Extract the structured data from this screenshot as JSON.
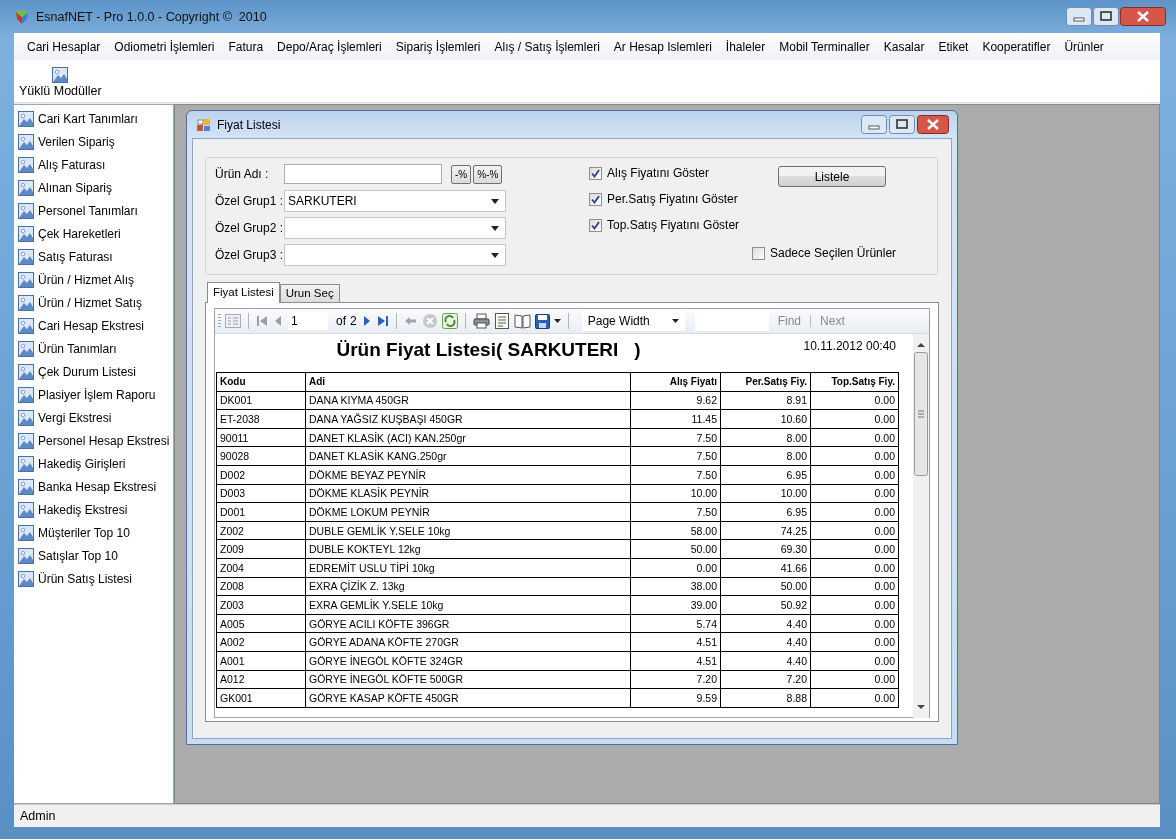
{
  "window": {
    "title": "EsnafNET - Pro 1.0.0 - Copyright ©  2010"
  },
  "menu": [
    "Cari Hesaplar",
    "Odiometri İşlemleri",
    "Fatura",
    "Depo/Araç İşlemleri",
    "Sipariş İşlemleri",
    "Alış / Satış İşlemleri",
    "Ar Hesap Islemleri",
    "İhaleler",
    "Mobil Terminaller",
    "Kasalar",
    "Etiket",
    "Kooperatifler",
    "Ürünler"
  ],
  "toolbar": [
    {
      "label": "Yüklü Modüller"
    }
  ],
  "sidebar": {
    "items": [
      "Cari Kart Tanımları",
      "Verilen Sipariş",
      "Alış Faturası",
      "Alınan Sipariş",
      "Personel Tanımları",
      "Çek Hareketleri",
      "Satış Faturası",
      "Ürün / Hizmet Alış",
      "Ürün / Hizmet Satış",
      "Cari Hesap Ekstresi",
      "Ürün Tanımları",
      "Çek Durum Listesi",
      "Plasiyer İşlem Raporu",
      "Vergi Ekstresi",
      "Personel Hesap Ekstresi",
      "Hakediş Girişleri",
      "Banka Hesap Ekstresi",
      "Hakediş Ekstresi",
      "Müşteriler Top 10",
      "Satışlar Top 10",
      "Ürün Satış Listesi"
    ]
  },
  "child_window": {
    "title": "Fiyat Listesi",
    "fields": [
      {
        "label": "Ürün Adı :",
        "kind": "text"
      },
      {
        "label": "Özel Grup1 :",
        "kind": "combo",
        "value": "SARKUTERI"
      },
      {
        "label": "Özel Grup2 :",
        "kind": "combo"
      },
      {
        "label": "Özel Grup3 :",
        "kind": "combo"
      }
    ],
    "pattern_buttons": [
      "-%",
      "%-%"
    ],
    "checkboxes": [
      {
        "label": "Alış Fiyatını Göster",
        "checked": true
      },
      {
        "label": "Per.Satış Fiyatını Göster",
        "checked": true
      },
      {
        "label": "Top.Satış Fiyatını Göster",
        "checked": true
      }
    ],
    "list_button": "Listele",
    "only_selected": {
      "label": "Sadece Seçilen Ürünler",
      "checked": false
    },
    "tabs": [
      {
        "label": "Fiyat Listesi",
        "selected": true
      },
      {
        "label": "Urun Seç",
        "selected": false
      }
    ],
    "report_toolbar": {
      "page": "1",
      "of": "of",
      "total": "2",
      "zoom": "Page Width",
      "find": {
        "label": "Find",
        "disabled": true
      },
      "next": {
        "label": "Next",
        "disabled": true
      }
    },
    "report": {
      "title": "Ürün Fiyat Listesi( SARKUTERI   )",
      "date": "10.11.2012 00:40",
      "columns": [
        {
          "label": "Kodu",
          "kind": "text"
        },
        {
          "label": "Adi",
          "kind": "text"
        },
        {
          "label": "Alış Fiyatı",
          "kind": "number"
        },
        {
          "label": "Per.Satış Fiy.",
          "kind": "number"
        },
        {
          "label": "Top.Satış Fiy.",
          "kind": "number"
        }
      ],
      "rows": [
        [
          "DK001",
          "DANA KIYMA 450GR",
          "9.62",
          "8.91",
          "0.00"
        ],
        [
          "ET-2038",
          "DANA YAĞSIZ KUŞBAŞI 450GR",
          "11.45",
          "10.60",
          "0.00"
        ],
        [
          "90011",
          "DANET KLASİK (ACI) KAN.250gr",
          "7.50",
          "8.00",
          "0.00"
        ],
        [
          "90028",
          "DANET KLASİK KANG.250gr",
          "7.50",
          "8.00",
          "0.00"
        ],
        [
          "D002",
          "DÖKME BEYAZ PEYNİR",
          "7.50",
          "6.95",
          "0.00"
        ],
        [
          "D003",
          "DÖKME KLASİK PEYNİR",
          "10.00",
          "10.00",
          "0.00"
        ],
        [
          "D001",
          "DÖKME LOKUM PEYNİR",
          "7.50",
          "6.95",
          "0.00"
        ],
        [
          "Z002",
          "DUBLE GEMLİK Y.SELE 10kg",
          "58.00",
          "74.25",
          "0.00"
        ],
        [
          "Z009",
          "DUBLE KOKTEYL 12kg",
          "50.00",
          "69.30",
          "0.00"
        ],
        [
          "Z004",
          "EDREMİT USLU TİPİ 10kg",
          "0.00",
          "41.66",
          "0.00"
        ],
        [
          "Z008",
          "EXRA ÇİZİK Z. 13kg",
          "38.00",
          "50.00",
          "0.00"
        ],
        [
          "Z003",
          "EXRA GEMLİK Y.SELE 10kg",
          "39.00",
          "50.92",
          "0.00"
        ],
        [
          "A005",
          "GÖRYE ACILI KÖFTE 396GR",
          "5.74",
          "4.40",
          "0.00"
        ],
        [
          "A002",
          "GÖRYE ADANA KÖFTE 270GR",
          "4.51",
          "4.40",
          "0.00"
        ],
        [
          "A001",
          "GÖRYE İNEGÖL KÖFTE 324GR",
          "4.51",
          "4.40",
          "0.00"
        ],
        [
          "A012",
          "GÖRYE İNEGÖL KÖFTE 500GR",
          "7.20",
          "7.20",
          "0.00"
        ],
        [
          "GK001",
          "GÖRYE KASAP KÖFTE 450GR",
          "9.59",
          "8.88",
          "0.00"
        ]
      ]
    }
  },
  "status_bar": {
    "user": "Admin"
  }
}
